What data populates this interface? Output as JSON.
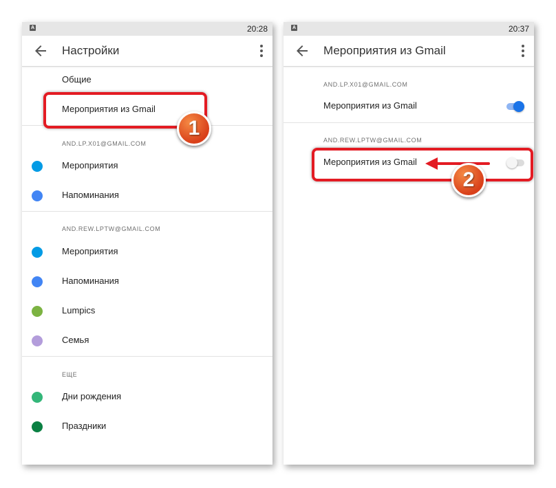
{
  "left": {
    "status_time": "20:28",
    "title": "Настройки",
    "general": "Общие",
    "gmail_events": "Мероприятия из Gmail",
    "account1": {
      "email": "AND.LP.X01@GMAIL.COM",
      "items": [
        {
          "label": "Мероприятия",
          "color": "#039be5"
        },
        {
          "label": "Напоминания",
          "color": "#4285f4"
        }
      ]
    },
    "account2": {
      "email": "AND.REW.LPTW@GMAIL.COM",
      "items": [
        {
          "label": "Мероприятия",
          "color": "#039be5"
        },
        {
          "label": "Напоминания",
          "color": "#4285f4"
        },
        {
          "label": "Lumpics",
          "color": "#7cb342"
        },
        {
          "label": "Семья",
          "color": "#b39ddb"
        }
      ]
    },
    "more": {
      "heading": "ЕЩЕ",
      "items": [
        {
          "label": "Дни рождения",
          "color": "#33b679"
        },
        {
          "label": "Праздники",
          "color": "#0b8043"
        }
      ]
    }
  },
  "right": {
    "status_time": "20:37",
    "title": "Мероприятия из Gmail",
    "account1": {
      "email": "AND.LP.X01@GMAIL.COM",
      "setting_label": "Мероприятия из Gmail",
      "enabled": true
    },
    "account2": {
      "email": "AND.REW.LPTW@GMAIL.COM",
      "setting_label": "Мероприятия из Gmail",
      "enabled": false
    }
  },
  "annotations": {
    "step1": "1",
    "step2": "2",
    "highlight_color": "#e31b23",
    "badge_color": "#e8582b"
  }
}
